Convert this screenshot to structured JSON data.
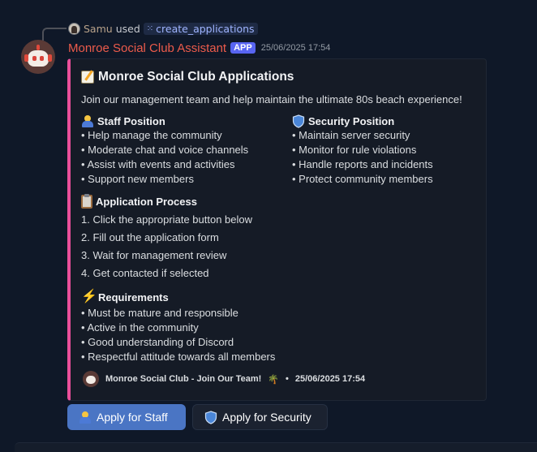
{
  "reply": {
    "user": "Samu",
    "used": "used",
    "command": "create_applications"
  },
  "message": {
    "author": "Monroe Social Club Assistant",
    "badge": "APP",
    "timestamp": "25/06/2025 17:54"
  },
  "embed": {
    "accent_color": "#ea4f9a",
    "title": "Monroe Social Club Applications",
    "description": "Join our management team and help maintain the ultimate 80s beach experience!",
    "staff": {
      "title": "Staff Position",
      "items": [
        "• Help manage the community",
        "• Moderate chat and voice channels",
        "• Assist with events and activities",
        "• Support new members"
      ]
    },
    "security": {
      "title": "Security Position",
      "items": [
        "• Maintain server security",
        "• Monitor for rule violations",
        "• Handle reports and incidents",
        "• Protect community members"
      ]
    },
    "process": {
      "title": "Application Process",
      "items": [
        "1. Click the appropriate button below",
        "2. Fill out the application form",
        "3. Wait for management review",
        "4. Get contacted if selected"
      ]
    },
    "requirements": {
      "title": "Requirements",
      "items": [
        "• Must be mature and responsible",
        "• Active in the community",
        "• Good understanding of Discord",
        "• Respectful attitude towards all members"
      ]
    },
    "footer": {
      "text": "Monroe Social Club - Join Our Team!",
      "separator": "•",
      "timestamp": "25/06/2025 17:54"
    }
  },
  "buttons": {
    "staff": "Apply for Staff",
    "security": "Apply for Security",
    "primary_color": "#4a75c4"
  },
  "icons": [
    "memo-icon",
    "person-icon",
    "shield-icon",
    "clipboard-icon",
    "lightning-icon",
    "palm-tree-icon"
  ]
}
